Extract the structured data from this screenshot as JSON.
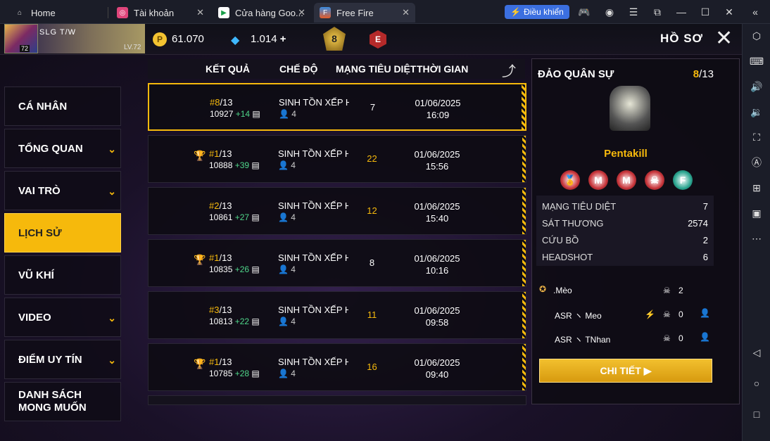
{
  "browser": {
    "tabs": [
      {
        "label": "Home"
      },
      {
        "label": "Tài khoản"
      },
      {
        "label": "Cửa hàng Goo..."
      },
      {
        "label": "Free Fire"
      }
    ],
    "control_button": "Điều khiển"
  },
  "player": {
    "name": "SLG",
    "tag": "T/W",
    "level_badge": "72",
    "level": "LV.72"
  },
  "currency": {
    "coins": "61.070",
    "diamonds": "1.014"
  },
  "rank_badge": "8",
  "e_badge": "E",
  "page_title": "HỒ SƠ",
  "sidebar": [
    {
      "label": "CÁ NHÂN"
    },
    {
      "label": "TỔNG QUAN"
    },
    {
      "label": "VAI TRÒ"
    },
    {
      "label": "LỊCH SỬ"
    },
    {
      "label": "VŨ KHÍ"
    },
    {
      "label": "VIDEO"
    },
    {
      "label": "ĐIỂM UY TÍN"
    },
    {
      "label": "DANH SÁCH MONG MUỐN"
    }
  ],
  "columns": {
    "result": "KẾT QUẢ",
    "mode": "CHẾ ĐỘ",
    "kills": "MẠNG TIÊU DIỆT",
    "time": "THỜI GIAN"
  },
  "matches": [
    {
      "rank": "#8",
      "total": "/13",
      "score": "10927",
      "delta": "+14",
      "mode": "SINH TỒN XẾP HẠ",
      "team": "4",
      "kills": "7",
      "date": "01/06/2025",
      "time": "16:09"
    },
    {
      "rank": "#1",
      "total": "/13",
      "score": "10888",
      "delta": "+39",
      "mode": "SINH TỒN XẾP HẠ",
      "team": "4",
      "kills": "22",
      "date": "01/06/2025",
      "time": "15:56"
    },
    {
      "rank": "#2",
      "total": "/13",
      "score": "10861",
      "delta": "+27",
      "mode": "SINH TỒN XẾP HẠ",
      "team": "4",
      "kills": "12",
      "date": "01/06/2025",
      "time": "15:40"
    },
    {
      "rank": "#1",
      "total": "/13",
      "score": "10835",
      "delta": "+26",
      "mode": "SINH TỒN XẾP HẠ",
      "team": "4",
      "kills": "8",
      "date": "01/06/2025",
      "time": "10:16"
    },
    {
      "rank": "#3",
      "total": "/13",
      "score": "10813",
      "delta": "+22",
      "mode": "SINH TỒN XẾP HẠ",
      "team": "4",
      "kills": "11",
      "date": "01/06/2025",
      "time": "09:58"
    },
    {
      "rank": "#1",
      "total": "/13",
      "score": "10785",
      "delta": "+28",
      "mode": "SINH TỒN XẾP HẠ",
      "team": "4",
      "kills": "16",
      "date": "01/06/2025",
      "time": "09:40"
    }
  ],
  "panel": {
    "map": "ĐẢO QUÂN SỰ",
    "rank": "8",
    "total": "/13",
    "mvp_title": "Pentakill",
    "stats": [
      {
        "label": "MẠNG TIÊU DIỆT",
        "value": "7"
      },
      {
        "label": "SÁT THƯƠNG",
        "value": "2574"
      },
      {
        "label": "CỨU BỒ",
        "value": "2"
      },
      {
        "label": "HEADSHOT",
        "value": "6"
      }
    ],
    "players": [
      {
        "name": ".Mèo",
        "kills": "2"
      },
      {
        "name": "ASR ヽ Meo",
        "kills": "0"
      },
      {
        "name": "ASR ヽ TNhan",
        "kills": "0"
      }
    ],
    "detail_button": "CHI TIẾT"
  },
  "medals": [
    "🏅",
    "M",
    "M",
    "☠",
    "F"
  ]
}
